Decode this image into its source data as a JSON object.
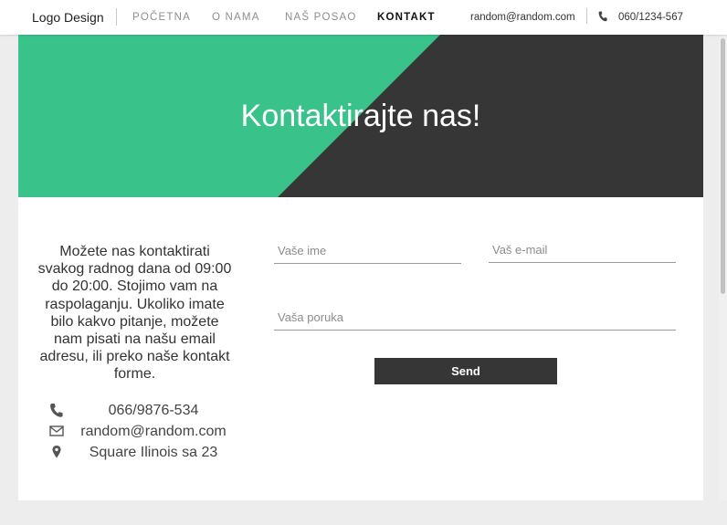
{
  "navbar": {
    "logo": "Logo Design",
    "links": [
      "POČETNA",
      "O NAMA",
      "NAŠ POSAO",
      "KONTAKT"
    ],
    "email": "random@random.com",
    "phone": "060/1234-567"
  },
  "hero": {
    "title": "Kontaktirajte nas!"
  },
  "contact_info": {
    "intro": "Možete nas kontaktirati svakog radnog dana od 09:00 do 20:00. Stojimo vam na raspolaganju. Ukoliko imate bilo kakvo pitanje, možete nam pisati na našu email adresu, ili preko naše kontakt forme.",
    "phone": "066/9876-534",
    "email": "random@random.com",
    "address": "Square Ilinois sa 23"
  },
  "form": {
    "name_placeholder": "Vaše ime",
    "email_placeholder": "Vaš e-mail",
    "message_placeholder": "Vaša poruka",
    "send_label": "Send"
  },
  "colors": {
    "accent_green": "#3ac28b",
    "dark": "#363636"
  }
}
